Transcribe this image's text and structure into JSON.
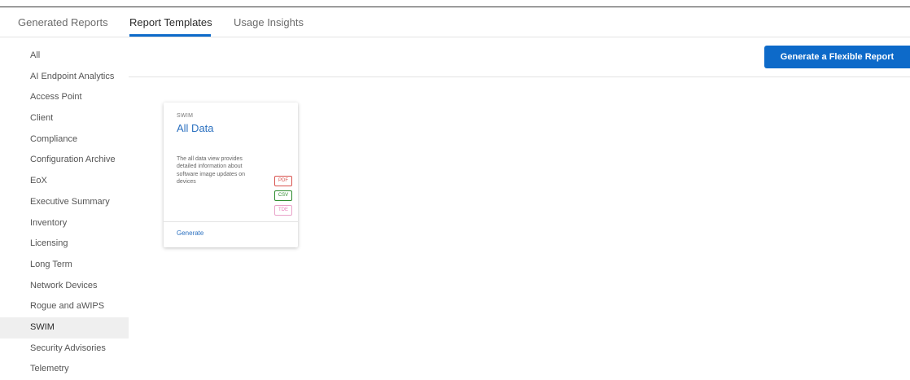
{
  "tabs": [
    {
      "label": "Generated Reports"
    },
    {
      "label": "Report Templates"
    },
    {
      "label": "Usage Insights"
    }
  ],
  "active_tab": "Report Templates",
  "sidebar": {
    "items": [
      {
        "label": "All"
      },
      {
        "label": "AI Endpoint Analytics"
      },
      {
        "label": "Access Point"
      },
      {
        "label": "Client"
      },
      {
        "label": "Compliance"
      },
      {
        "label": "Configuration Archive"
      },
      {
        "label": "EoX"
      },
      {
        "label": "Executive Summary"
      },
      {
        "label": "Inventory"
      },
      {
        "label": "Licensing"
      },
      {
        "label": "Long Term"
      },
      {
        "label": "Network Devices"
      },
      {
        "label": "Rogue and aWIPS"
      },
      {
        "label": "SWIM"
      },
      {
        "label": "Security Advisories"
      },
      {
        "label": "Telemetry"
      }
    ],
    "active": "SWIM"
  },
  "toolbar": {
    "generate_flexible_label": "Generate a Flexible Report"
  },
  "card": {
    "category": "SWIM",
    "title": "All Data",
    "description": "The all data view provides detailed information about software image updates on devices",
    "formats": [
      "PDF",
      "CSV",
      "TDE"
    ],
    "action_label": "Generate"
  },
  "colors": {
    "accent": "#0d6ac9",
    "link": "#2c71c0",
    "pdf": "#d9534f",
    "csv": "#2e8b2e",
    "tde": "#e87ab8"
  }
}
